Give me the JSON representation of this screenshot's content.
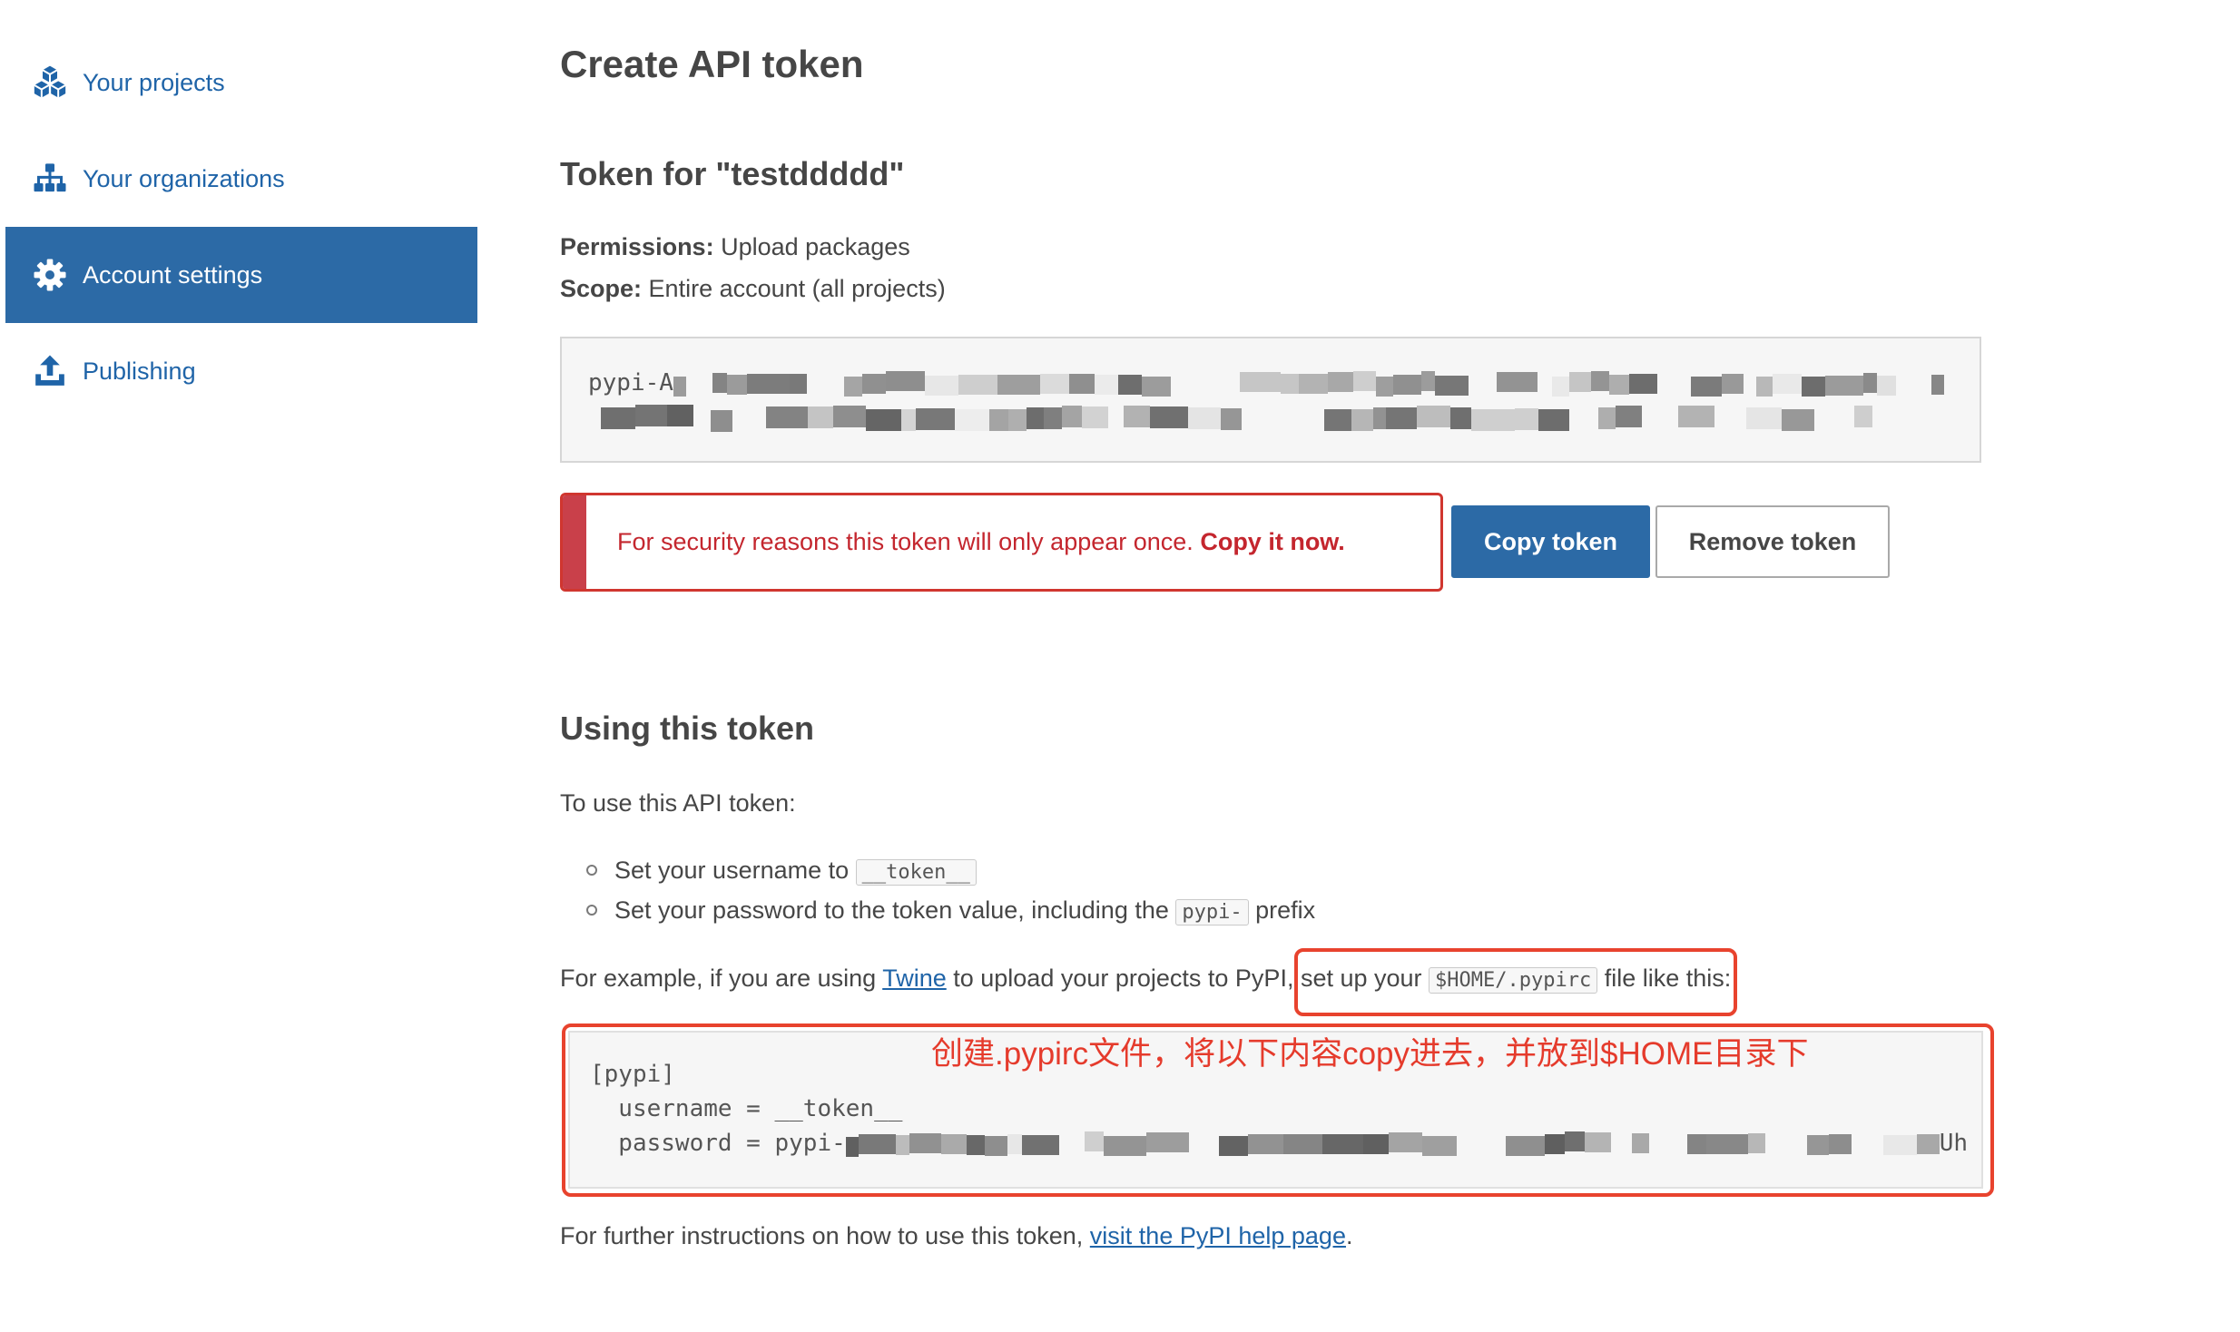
{
  "sidebar": {
    "items": [
      {
        "label": "Your projects",
        "icon": "cubes-icon",
        "active": false
      },
      {
        "label": "Your organizations",
        "icon": "sitemap-icon",
        "active": false
      },
      {
        "label": "Account settings",
        "icon": "gear-icon",
        "active": true
      },
      {
        "label": "Publishing",
        "icon": "upload-icon",
        "active": false
      }
    ]
  },
  "page": {
    "title": "Create API token"
  },
  "token_section": {
    "heading": "Token for \"testddddd\"",
    "permissions_label": "Permissions:",
    "permissions_value": "Upload packages",
    "scope_label": "Scope:",
    "scope_value": "Entire account (all projects)",
    "token_visible_prefix": "pypi-A",
    "alert_text": "For security reasons this token will only appear once.",
    "alert_emphasis": "Copy it now.",
    "copy_label": "Copy token",
    "remove_label": "Remove token"
  },
  "usage": {
    "heading": "Using this token",
    "intro": "To use this API token:",
    "steps": [
      {
        "text": "Set your username to ",
        "code": "__token__",
        "after": ""
      },
      {
        "text": "Set your password to the token value, including the ",
        "code": "pypi-",
        "after": " prefix"
      }
    ],
    "example": {
      "before": "For example, if you are using ",
      "link": "Twine",
      "middle": " to upload your projects to PyPI, ",
      "highlight_before": "set up your ",
      "highlight_code": "$HOME/.pypirc",
      "highlight_after": " file like this:"
    },
    "code": {
      "line1": "[pypi]",
      "line2": "  username = __token__",
      "line3": "  password = pypi-",
      "line3_tail": "Uh"
    },
    "footer": {
      "before": "For further instructions on how to use this token, ",
      "link": "visit the PyPI help page",
      "after": "."
    }
  },
  "annotation": {
    "note": "创建.pypirc文件，将以下内容copy进去，并放到$HOME目录下"
  },
  "colors": {
    "brand": "#2c6aa6",
    "link": "#1f64a8",
    "text": "#464646",
    "danger": "#c4262e",
    "annotation": "#e8432e"
  }
}
